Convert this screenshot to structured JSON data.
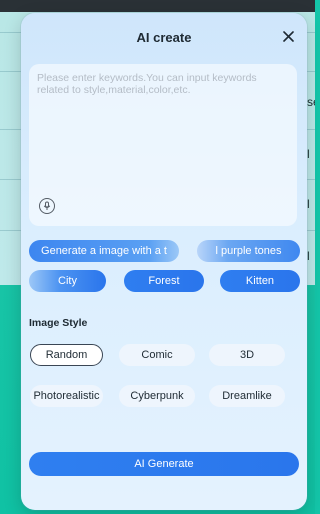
{
  "background": {
    "partial_labels": [
      "se",
      "l",
      "l",
      "l"
    ]
  },
  "dialog": {
    "title": "AI create",
    "close_symbol": "✕",
    "keyword_input": {
      "value": "",
      "placeholder": "Please enter keywords.You can input keywords related to style,material,color,etc."
    },
    "mic_icon": "microphone-icon",
    "suggestions": [
      "Generate a image with a t",
      "l purple tones"
    ],
    "tags": [
      "City",
      "Forest",
      "Kitten"
    ],
    "image_style": {
      "label": "Image Style",
      "selected": "Random",
      "options": [
        "Random",
        "Comic",
        "3D",
        "Photorealistic",
        "Cyberpunk",
        "Dreamlike"
      ]
    },
    "generate_label": "AI Generate"
  },
  "colors": {
    "accent": "#2f7ff0",
    "dialog_bg": "#d8ecfd",
    "app_teal": "#14c6a9"
  }
}
